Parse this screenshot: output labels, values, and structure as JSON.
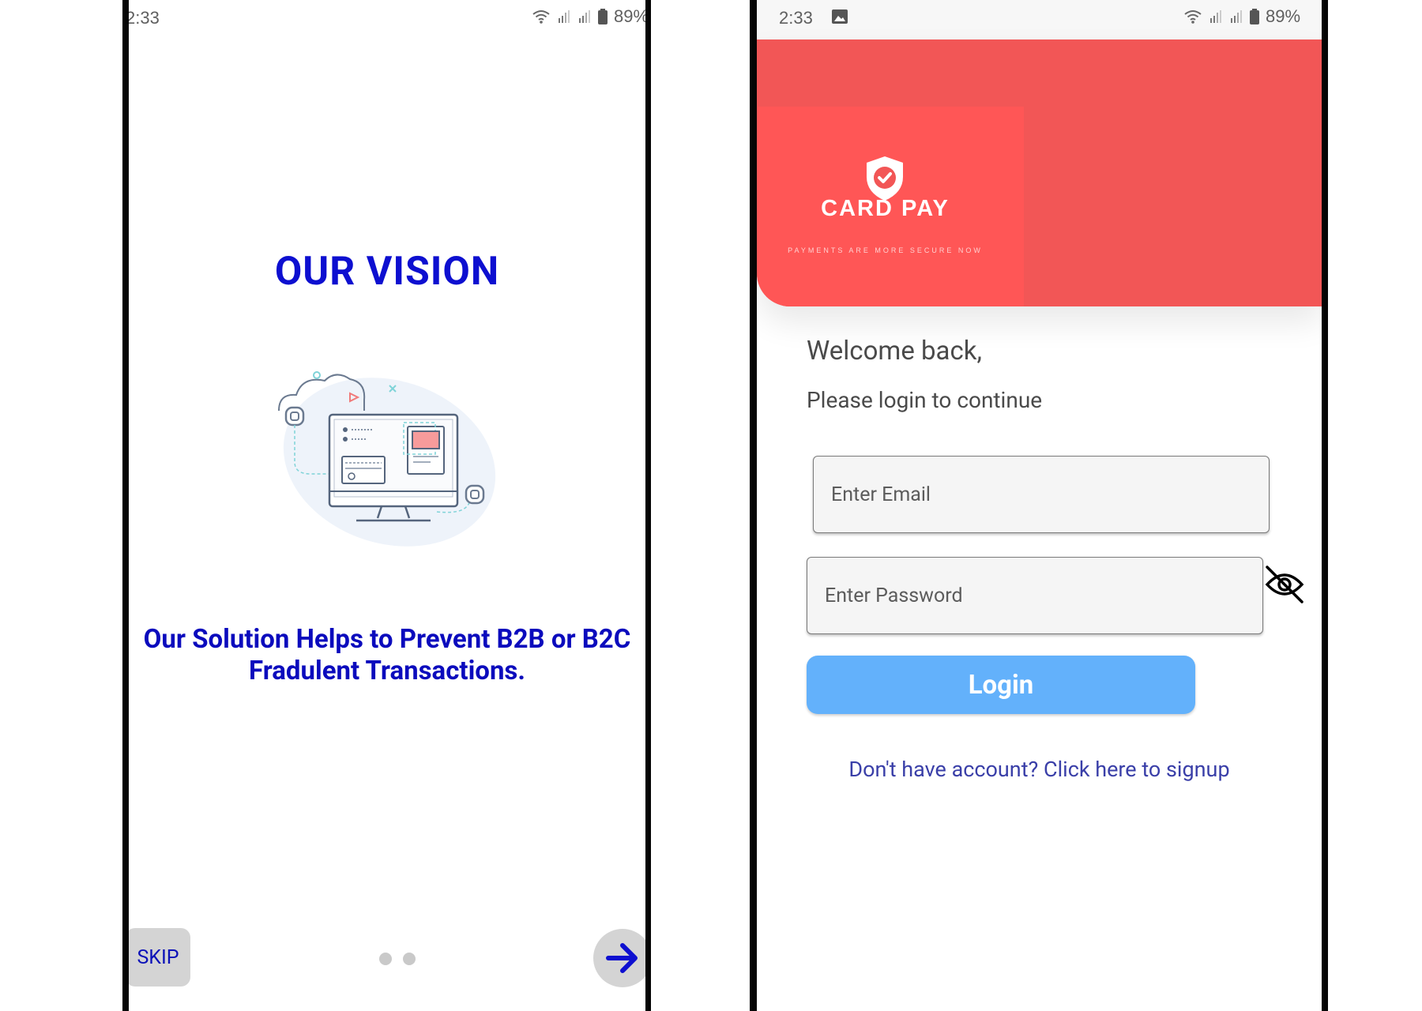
{
  "screen1": {
    "status": {
      "time": "2:33",
      "battery": "89%"
    },
    "title": "OUR VISION",
    "description": "Our Solution Helps to Prevent B2B or B2C Fradulent Transactions.",
    "skip_label": "SKIP",
    "page_indicator": {
      "count": 2
    },
    "icons": {
      "next": "arrow-right-icon",
      "illustration": "payment-monitor-illustration"
    }
  },
  "screen2": {
    "status": {
      "time": "2:33",
      "battery": "89%"
    },
    "brand": {
      "name": "CARD PAY",
      "tagline": "PAYMENTS ARE MORE SECURE NOW"
    },
    "welcome": "Welcome back,",
    "subtitle": "Please login to continue",
    "email_placeholder": "Enter Email",
    "password_placeholder": "Enter Password",
    "login_label": "Login",
    "signup_text": "Don't have account? Click here to signup",
    "icons": {
      "password_visibility": "eye-off-icon",
      "logo": "shield-check-icon"
    }
  },
  "colors": {
    "vision_blue": "#0d0fd0",
    "banner_red": "#f25656",
    "login_blue": "#63b1fb",
    "link_blue": "#3a3fa8"
  }
}
